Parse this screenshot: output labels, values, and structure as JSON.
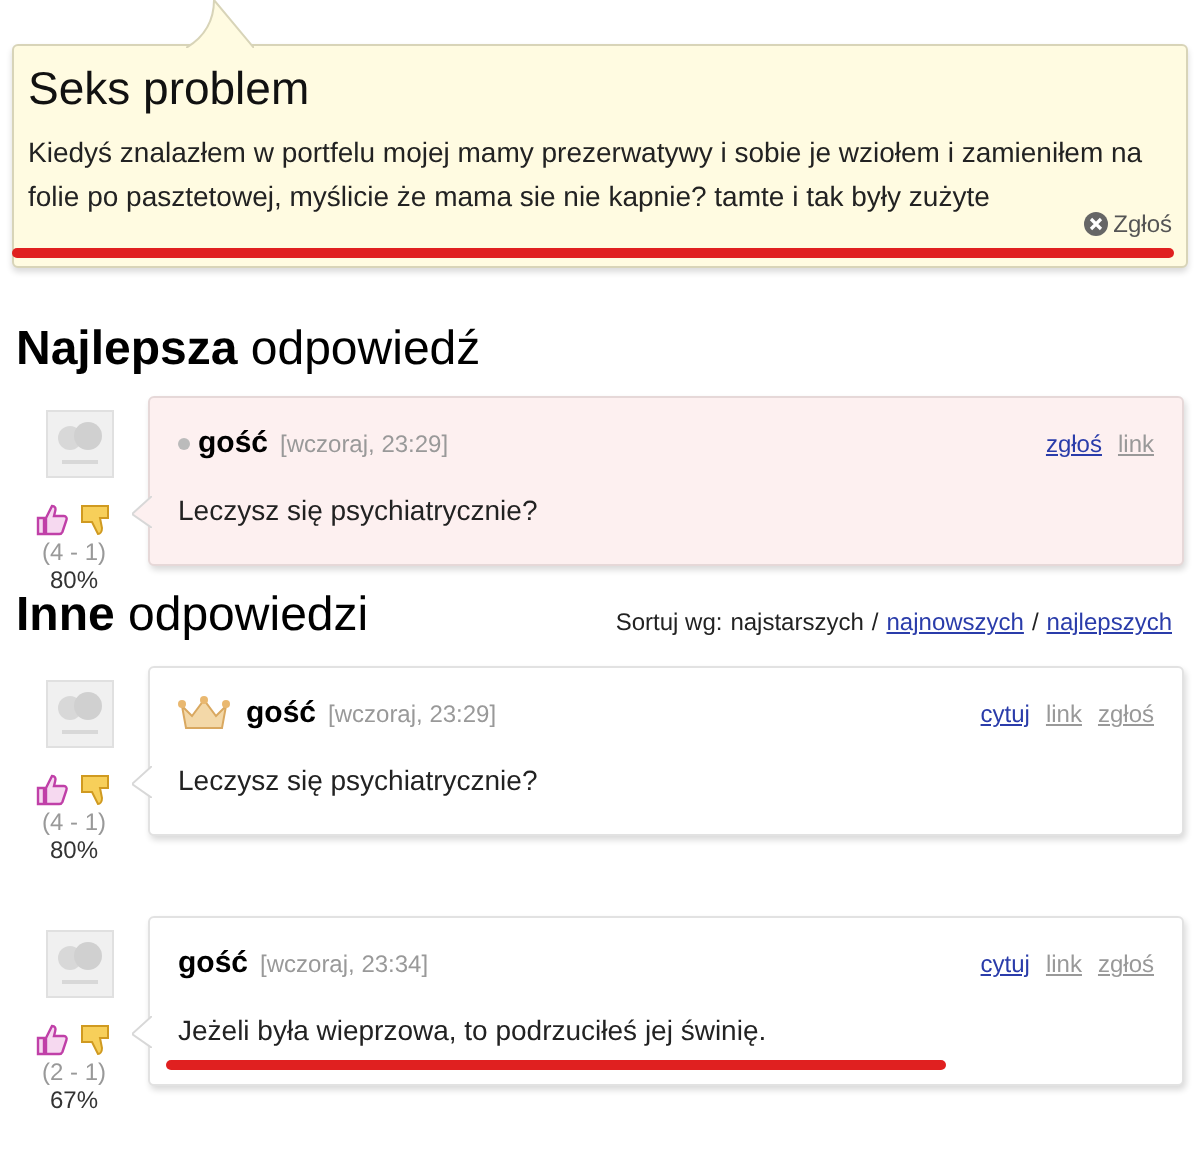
{
  "question": {
    "title": "Seks problem",
    "text": "Kiedyś znalazłem w portfelu mojej mamy prezerwatywy i sobie je wziołem i zamieniłem na folie po pasztetowej, myślicie że mama sie nie kapnie? tamte i tak były zużyte",
    "underlined": true,
    "report": "Zgłoś"
  },
  "best_heading": {
    "bold": "Najlepsza",
    "rest": "odpowiedź"
  },
  "best_answers": [
    {
      "highlighted": true,
      "badge": {
        "kind": "dot"
      },
      "author": "gość",
      "time": "[wczoraj, 23:29]",
      "text": "Leczysz się psychiatrycznie?",
      "votes": "(4 - 1)",
      "percent": "80%",
      "links": [
        {
          "label": "zgłoś",
          "active": true
        },
        {
          "label": "link",
          "active": false
        }
      ]
    }
  ],
  "other_heading": {
    "bold": "Inne",
    "rest": "odpowiedzi"
  },
  "sort": {
    "label": "Sortuj wg:",
    "separator": "/",
    "options": [
      {
        "label": "najstarszych",
        "selected": true
      },
      {
        "label": "najnowszych",
        "selected": false
      },
      {
        "label": "najlepszych",
        "selected": false
      }
    ]
  },
  "answers": [
    {
      "highlighted": false,
      "badge": {
        "kind": "crown"
      },
      "author": "gość",
      "time": "[wczoraj, 23:29]",
      "text": "Leczysz się psychiatrycznie?",
      "votes": "(4 - 1)",
      "percent": "80%",
      "links": [
        {
          "label": "cytuj",
          "active": true
        },
        {
          "label": "link",
          "active": false
        },
        {
          "label": "zgłoś",
          "active": false
        }
      ]
    },
    {
      "highlighted": false,
      "author": "gość",
      "time": "[wczoraj, 23:34]",
      "text": "Jeżeli była wieprzowa, to podrzuciłeś jej świnię.",
      "underlined": true,
      "votes": "(2 - 1)",
      "percent": "67%",
      "links": [
        {
          "label": "cytuj",
          "active": true
        },
        {
          "label": "link",
          "active": false
        },
        {
          "label": "zgłoś",
          "active": false
        }
      ]
    }
  ]
}
